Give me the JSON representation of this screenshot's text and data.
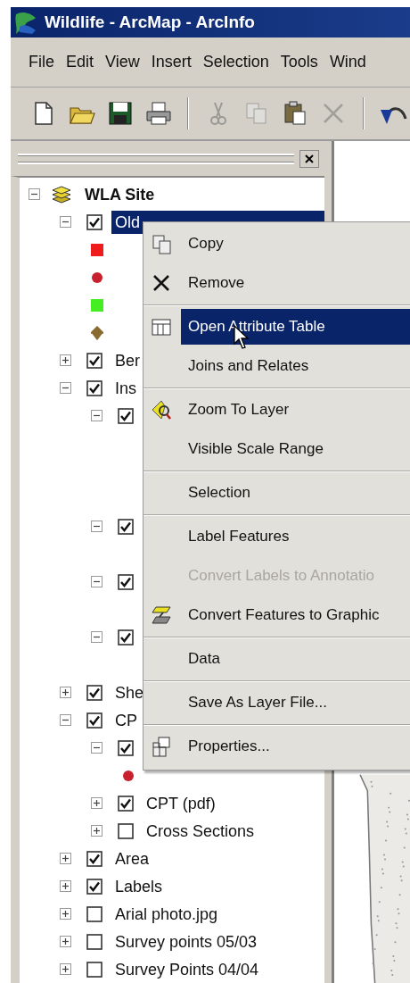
{
  "window": {
    "title": "Wildlife - ArcMap - ArcInfo"
  },
  "menu_bar": [
    "File",
    "Edit",
    "View",
    "Insert",
    "Selection",
    "Tools",
    "Wind"
  ],
  "toolbar": {
    "groups": [
      [
        {
          "kind": "new",
          "disabled": false
        },
        {
          "kind": "open",
          "disabled": false
        },
        {
          "kind": "save",
          "disabled": false
        },
        {
          "kind": "print",
          "disabled": false
        }
      ],
      [
        {
          "kind": "cut",
          "disabled": true
        },
        {
          "kind": "copy",
          "disabled": true
        },
        {
          "kind": "paste",
          "disabled": false
        },
        {
          "kind": "delete",
          "disabled": true
        }
      ],
      [
        {
          "kind": "undo",
          "disabled": false
        }
      ]
    ]
  },
  "table_of_contents": {
    "layers": [
      {
        "label": "WLA Site",
        "kind": "frame",
        "expanded": true,
        "children": [
          {
            "label": "Old",
            "kind": "layer",
            "expanded": true,
            "checked": true,
            "selected": true,
            "children": [
              {
                "kind": "square",
                "color": "#ee1c1c"
              },
              {
                "kind": "circle",
                "color": "#c8202c"
              },
              {
                "kind": "square",
                "color": "#44ee22"
              },
              {
                "kind": "marker",
                "color": "#8a6a30"
              }
            ]
          },
          {
            "label": "Ber",
            "kind": "layer",
            "expanded": false,
            "checked": true,
            "selected": false
          },
          {
            "label": "Ins",
            "kind": "layer",
            "expanded": true,
            "checked": true,
            "selected": false,
            "children": [
              {
                "kind": "layer",
                "expanded": true,
                "checked": true
              },
              {
                "kind": "layer",
                "expanded": true,
                "checked": true
              },
              {
                "kind": "layer",
                "expanded": true,
                "checked": true
              },
              {
                "kind": "layer",
                "expanded": true,
                "checked": true
              }
            ]
          },
          {
            "label": "She",
            "kind": "layer",
            "expanded": false,
            "checked": true,
            "selected": false
          },
          {
            "label": "CP",
            "kind": "layer",
            "expanded": true,
            "checked": true,
            "selected": false,
            "children": [
              {
                "kind": "layer",
                "expanded": true,
                "checked": true,
                "children": [
                  {
                    "kind": "circle",
                    "color": "#c8202c"
                  }
                ]
              },
              {
                "label": "CPT (pdf)",
                "kind": "layer",
                "expanded": false,
                "checked": true,
                "selected": false
              },
              {
                "label": "Cross Sections",
                "kind": "layer",
                "expanded": false,
                "checked": false,
                "selected": false
              }
            ]
          },
          {
            "label": "Area",
            "kind": "layer",
            "expanded": false,
            "checked": true,
            "selected": false
          },
          {
            "label": "Labels",
            "kind": "layer",
            "expanded": false,
            "checked": true,
            "selected": false
          },
          {
            "label": "Arial photo.jpg",
            "kind": "layer",
            "expanded": false,
            "checked": false,
            "selected": false
          },
          {
            "label": "Survey points 05/03",
            "kind": "layer",
            "expanded": false,
            "checked": false,
            "selected": false
          },
          {
            "label": "Survey Points 04/04",
            "kind": "layer",
            "expanded": false,
            "checked": false,
            "selected": false
          }
        ]
      }
    ]
  },
  "map": {
    "kind": "picture"
  },
  "context_menu": {
    "groups": [
      [
        {
          "label": "Copy",
          "kind": "copy",
          "disabled": false,
          "selected": false
        },
        {
          "label": "Remove",
          "kind": "remove",
          "disabled": false,
          "selected": false
        }
      ],
      [
        {
          "label": "Open Attribute Table",
          "kind": "table",
          "disabled": false,
          "selected": true
        },
        {
          "label": "Joins and Relates",
          "kind": "plain",
          "disabled": false,
          "selected": false
        }
      ],
      [
        {
          "label": "Zoom To Layer",
          "kind": "zoom",
          "disabled": false,
          "selected": false
        },
        {
          "label": "Visible Scale Range",
          "kind": "plain",
          "disabled": false,
          "selected": false
        }
      ],
      [
        {
          "label": "Selection",
          "kind": "plain",
          "disabled": false,
          "selected": false
        }
      ],
      [
        {
          "label": "Label Features",
          "kind": "plain",
          "disabled": false,
          "selected": false
        },
        {
          "label": "Convert Labels to Annotatio",
          "kind": "plain",
          "disabled": true,
          "selected": false
        },
        {
          "label": "Convert Features to Graphic",
          "kind": "convert",
          "disabled": false,
          "selected": false
        }
      ],
      [
        {
          "label": "Data",
          "kind": "plain",
          "disabled": false,
          "selected": false
        }
      ],
      [
        {
          "label": "Save As Layer File...",
          "kind": "plain",
          "disabled": false,
          "selected": false
        }
      ],
      [
        {
          "label": "Properties...",
          "kind": "properties",
          "disabled": false,
          "selected": false
        }
      ]
    ]
  }
}
